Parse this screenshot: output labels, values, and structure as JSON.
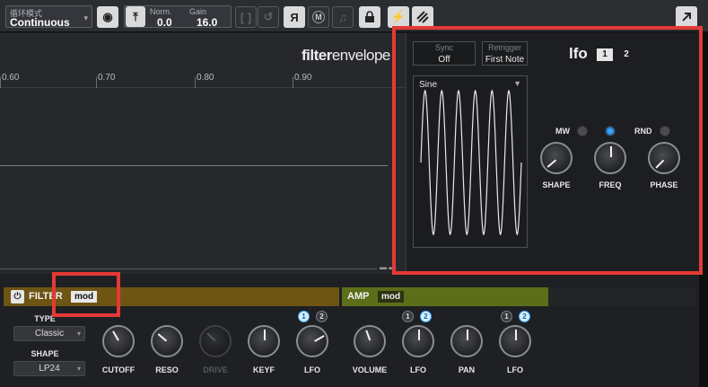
{
  "toolbar": {
    "loop_mode_label": "循环模式",
    "loop_mode_value": "Continuous",
    "normalize_label": "Norm.",
    "normalize_value": "0.0",
    "gain_label": "Gain",
    "gain_value": "16.0",
    "reverse_glyph": "Я",
    "m_glyph": "M"
  },
  "editor": {
    "brand_bold": "filter",
    "brand_light": "envelope",
    "ruler_ticks": [
      "0.60",
      "0.70",
      "0.80",
      "0.90"
    ]
  },
  "lfo": {
    "title": "lfo",
    "tabs": [
      "1",
      "2"
    ],
    "active_tab": "1",
    "sync_label": "Sync",
    "sync_value": "Off",
    "retrigger_label": "Retrigger",
    "retrigger_value": "First Note",
    "waveform": "Sine",
    "toggles": [
      {
        "label": "MW",
        "on": false
      },
      {
        "label": "",
        "on": true
      },
      {
        "label": "RND",
        "on": false
      }
    ],
    "knobs": [
      "SHAPE",
      "FREQ",
      "PHASE"
    ]
  },
  "filter": {
    "title": "FILTER",
    "mod_tag": "mod",
    "type_label": "TYPE",
    "type_value": "Classic",
    "shape_label": "SHAPE",
    "shape_value": "LP24",
    "knobs": [
      "CUTOFF",
      "RESO",
      "DRIVE",
      "KEYF",
      "LFO"
    ],
    "lfo_select": [
      "1",
      "2"
    ],
    "lfo_select_active": "1"
  },
  "amp": {
    "title": "AMP",
    "mod_tag": "mod",
    "knobs": [
      "VOLUME",
      "LFO",
      "PAN",
      "LFO"
    ],
    "lfo_select_a": [
      "1",
      "2"
    ],
    "lfo_select_a_active": "2",
    "lfo_select_b": [
      "1",
      "2"
    ],
    "lfo_select_b_active": "2"
  },
  "colors": {
    "filter_header": "#6e5514",
    "amp_header": "#5d6e1a",
    "led_on": "#3aa6ff",
    "annotation": "#e53935"
  }
}
